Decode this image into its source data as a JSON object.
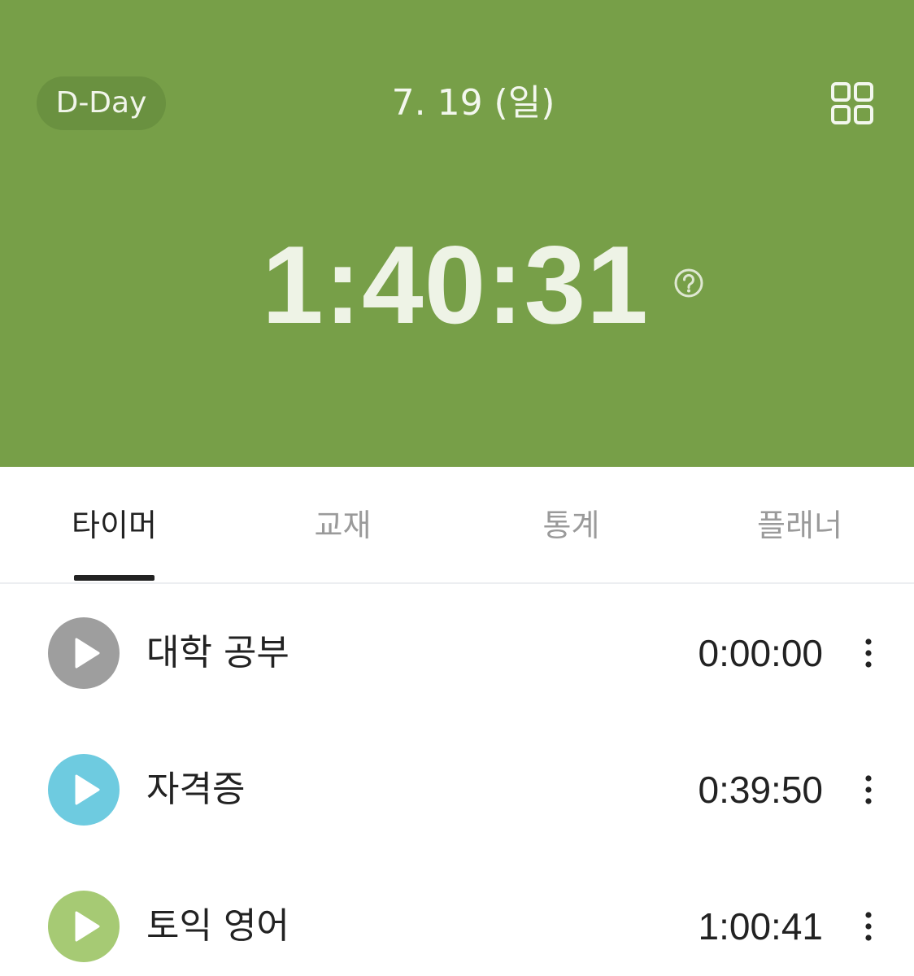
{
  "header": {
    "dday_label": "D-Day",
    "date_label": "7. 19 (일)",
    "total_timer": "1:40:31",
    "background_color": "#779f48",
    "help_icon": "question-circle-icon",
    "menu_icon": "grid-icon"
  },
  "tabs": [
    {
      "label": "타이머",
      "active": true
    },
    {
      "label": "교재",
      "active": false
    },
    {
      "label": "통계",
      "active": false
    },
    {
      "label": "플래너",
      "active": false
    }
  ],
  "subjects": [
    {
      "name": "대학 공부",
      "time": "0:00:00",
      "color": "#9e9e9e",
      "icon": "play-icon"
    },
    {
      "name": "자격증",
      "time": "0:39:50",
      "color": "#6ecbe0",
      "icon": "play-icon"
    },
    {
      "name": "토익 영어",
      "time": "1:00:41",
      "color": "#a6ca74",
      "icon": "play-icon"
    }
  ],
  "row_menu_icon": "more-vertical-icon"
}
